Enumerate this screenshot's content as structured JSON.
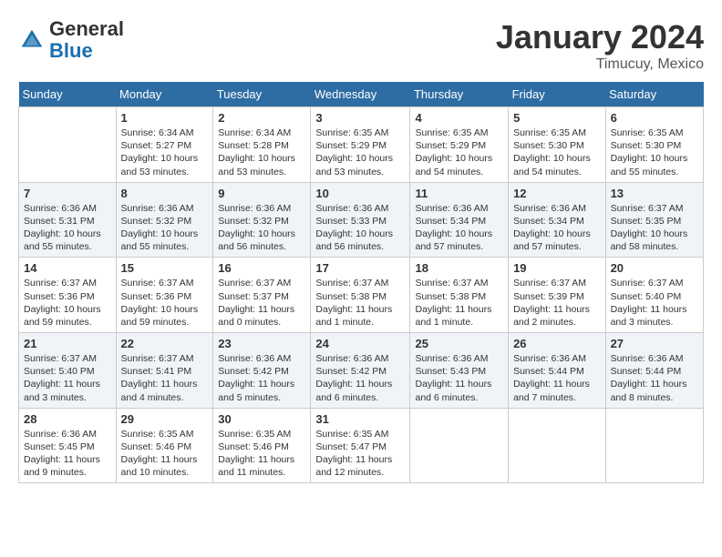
{
  "header": {
    "logo_general": "General",
    "logo_blue": "Blue",
    "month_title": "January 2024",
    "location": "Timucuy, Mexico"
  },
  "days_of_week": [
    "Sunday",
    "Monday",
    "Tuesday",
    "Wednesday",
    "Thursday",
    "Friday",
    "Saturday"
  ],
  "weeks": [
    [
      {
        "day": "",
        "empty": true
      },
      {
        "day": "1",
        "sunrise": "Sunrise: 6:34 AM",
        "sunset": "Sunset: 5:27 PM",
        "daylight": "Daylight: 10 hours and 53 minutes."
      },
      {
        "day": "2",
        "sunrise": "Sunrise: 6:34 AM",
        "sunset": "Sunset: 5:28 PM",
        "daylight": "Daylight: 10 hours and 53 minutes."
      },
      {
        "day": "3",
        "sunrise": "Sunrise: 6:35 AM",
        "sunset": "Sunset: 5:29 PM",
        "daylight": "Daylight: 10 hours and 53 minutes."
      },
      {
        "day": "4",
        "sunrise": "Sunrise: 6:35 AM",
        "sunset": "Sunset: 5:29 PM",
        "daylight": "Daylight: 10 hours and 54 minutes."
      },
      {
        "day": "5",
        "sunrise": "Sunrise: 6:35 AM",
        "sunset": "Sunset: 5:30 PM",
        "daylight": "Daylight: 10 hours and 54 minutes."
      },
      {
        "day": "6",
        "sunrise": "Sunrise: 6:35 AM",
        "sunset": "Sunset: 5:30 PM",
        "daylight": "Daylight: 10 hours and 55 minutes."
      }
    ],
    [
      {
        "day": "7",
        "sunrise": "Sunrise: 6:36 AM",
        "sunset": "Sunset: 5:31 PM",
        "daylight": "Daylight: 10 hours and 55 minutes."
      },
      {
        "day": "8",
        "sunrise": "Sunrise: 6:36 AM",
        "sunset": "Sunset: 5:32 PM",
        "daylight": "Daylight: 10 hours and 55 minutes."
      },
      {
        "day": "9",
        "sunrise": "Sunrise: 6:36 AM",
        "sunset": "Sunset: 5:32 PM",
        "daylight": "Daylight: 10 hours and 56 minutes."
      },
      {
        "day": "10",
        "sunrise": "Sunrise: 6:36 AM",
        "sunset": "Sunset: 5:33 PM",
        "daylight": "Daylight: 10 hours and 56 minutes."
      },
      {
        "day": "11",
        "sunrise": "Sunrise: 6:36 AM",
        "sunset": "Sunset: 5:34 PM",
        "daylight": "Daylight: 10 hours and 57 minutes."
      },
      {
        "day": "12",
        "sunrise": "Sunrise: 6:36 AM",
        "sunset": "Sunset: 5:34 PM",
        "daylight": "Daylight: 10 hours and 57 minutes."
      },
      {
        "day": "13",
        "sunrise": "Sunrise: 6:37 AM",
        "sunset": "Sunset: 5:35 PM",
        "daylight": "Daylight: 10 hours and 58 minutes."
      }
    ],
    [
      {
        "day": "14",
        "sunrise": "Sunrise: 6:37 AM",
        "sunset": "Sunset: 5:36 PM",
        "daylight": "Daylight: 10 hours and 59 minutes."
      },
      {
        "day": "15",
        "sunrise": "Sunrise: 6:37 AM",
        "sunset": "Sunset: 5:36 PM",
        "daylight": "Daylight: 10 hours and 59 minutes."
      },
      {
        "day": "16",
        "sunrise": "Sunrise: 6:37 AM",
        "sunset": "Sunset: 5:37 PM",
        "daylight": "Daylight: 11 hours and 0 minutes."
      },
      {
        "day": "17",
        "sunrise": "Sunrise: 6:37 AM",
        "sunset": "Sunset: 5:38 PM",
        "daylight": "Daylight: 11 hours and 1 minute."
      },
      {
        "day": "18",
        "sunrise": "Sunrise: 6:37 AM",
        "sunset": "Sunset: 5:38 PM",
        "daylight": "Daylight: 11 hours and 1 minute."
      },
      {
        "day": "19",
        "sunrise": "Sunrise: 6:37 AM",
        "sunset": "Sunset: 5:39 PM",
        "daylight": "Daylight: 11 hours and 2 minutes."
      },
      {
        "day": "20",
        "sunrise": "Sunrise: 6:37 AM",
        "sunset": "Sunset: 5:40 PM",
        "daylight": "Daylight: 11 hours and 3 minutes."
      }
    ],
    [
      {
        "day": "21",
        "sunrise": "Sunrise: 6:37 AM",
        "sunset": "Sunset: 5:40 PM",
        "daylight": "Daylight: 11 hours and 3 minutes."
      },
      {
        "day": "22",
        "sunrise": "Sunrise: 6:37 AM",
        "sunset": "Sunset: 5:41 PM",
        "daylight": "Daylight: 11 hours and 4 minutes."
      },
      {
        "day": "23",
        "sunrise": "Sunrise: 6:36 AM",
        "sunset": "Sunset: 5:42 PM",
        "daylight": "Daylight: 11 hours and 5 minutes."
      },
      {
        "day": "24",
        "sunrise": "Sunrise: 6:36 AM",
        "sunset": "Sunset: 5:42 PM",
        "daylight": "Daylight: 11 hours and 6 minutes."
      },
      {
        "day": "25",
        "sunrise": "Sunrise: 6:36 AM",
        "sunset": "Sunset: 5:43 PM",
        "daylight": "Daylight: 11 hours and 6 minutes."
      },
      {
        "day": "26",
        "sunrise": "Sunrise: 6:36 AM",
        "sunset": "Sunset: 5:44 PM",
        "daylight": "Daylight: 11 hours and 7 minutes."
      },
      {
        "day": "27",
        "sunrise": "Sunrise: 6:36 AM",
        "sunset": "Sunset: 5:44 PM",
        "daylight": "Daylight: 11 hours and 8 minutes."
      }
    ],
    [
      {
        "day": "28",
        "sunrise": "Sunrise: 6:36 AM",
        "sunset": "Sunset: 5:45 PM",
        "daylight": "Daylight: 11 hours and 9 minutes."
      },
      {
        "day": "29",
        "sunrise": "Sunrise: 6:35 AM",
        "sunset": "Sunset: 5:46 PM",
        "daylight": "Daylight: 11 hours and 10 minutes."
      },
      {
        "day": "30",
        "sunrise": "Sunrise: 6:35 AM",
        "sunset": "Sunset: 5:46 PM",
        "daylight": "Daylight: 11 hours and 11 minutes."
      },
      {
        "day": "31",
        "sunrise": "Sunrise: 6:35 AM",
        "sunset": "Sunset: 5:47 PM",
        "daylight": "Daylight: 11 hours and 12 minutes."
      },
      {
        "day": "",
        "empty": true
      },
      {
        "day": "",
        "empty": true
      },
      {
        "day": "",
        "empty": true
      }
    ]
  ]
}
